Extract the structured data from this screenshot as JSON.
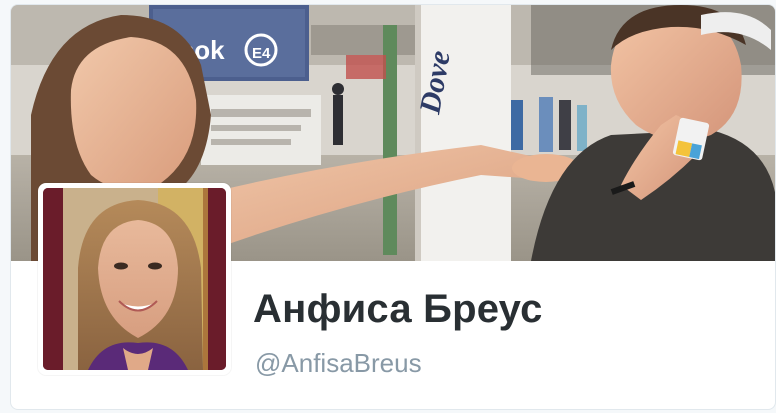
{
  "profile": {
    "display_name": "Анфиса Бреус",
    "screen_name": "@AnfisaBreus"
  },
  "banner": {
    "station_sign": "Asok",
    "station_code": "E4",
    "billboard_text": "Dove"
  },
  "colors": {
    "avatar_background": "#6a1c2a",
    "name_text": "#292f33",
    "handle_text": "#8899a6",
    "card_border": "#e1e8ed"
  }
}
